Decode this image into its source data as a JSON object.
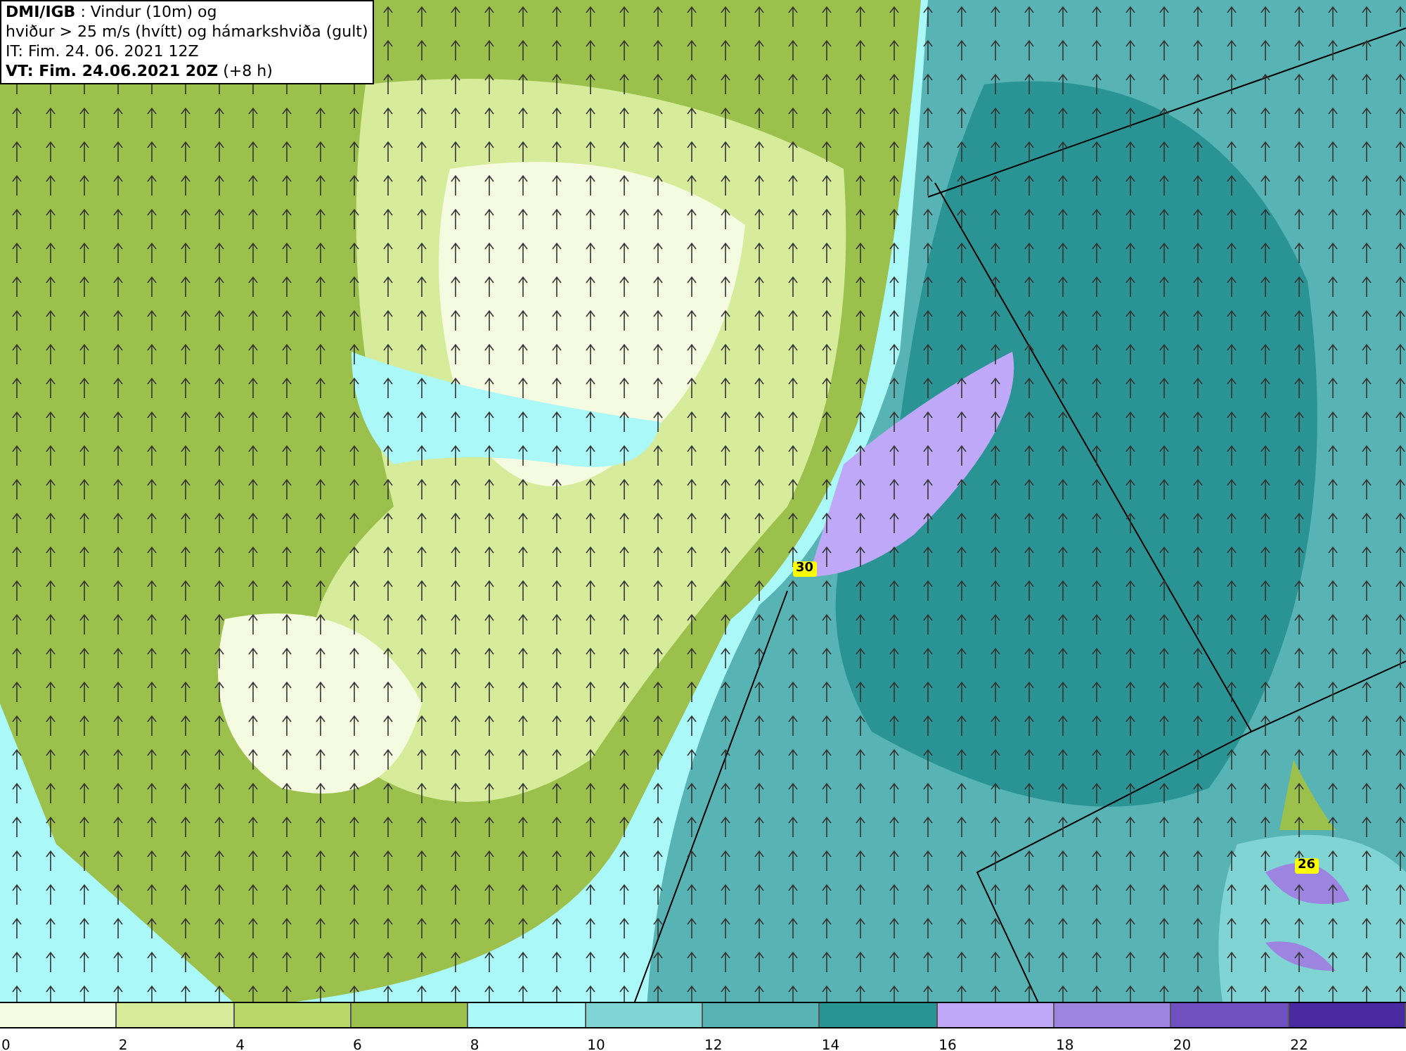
{
  "header": {
    "lines": [
      "**DMI/IGB** : Vindur (10m) og",
      "hviður > 25 m/s (hvítt) og hámarkshviða (gult)",
      "IT: Fim. 24. 06. 2021 12Z",
      "**VT: Fim. 24.06.2021 20Z** (+8 h)"
    ]
  },
  "gust_labels": [
    "30",
    "26"
  ],
  "legend": [
    {
      "label": "0",
      "color": "#f5fbe0"
    },
    {
      "label": "2",
      "color": "#d6ec9a"
    },
    {
      "label": "4",
      "color": "#b8d86a"
    },
    {
      "label": "6",
      "color": "#9cc04c"
    },
    {
      "label": "8",
      "color": "#aaf8f8"
    },
    {
      "label": "10",
      "color": "#80d4d4"
    },
    {
      "label": "12",
      "color": "#58b4b4"
    },
    {
      "label": "14",
      "color": "#2a9494"
    },
    {
      "label": "16",
      "color": "#c0a8f8"
    },
    {
      "label": "18",
      "color": "#9c84e0"
    },
    {
      "label": "20",
      "color": "#7050c0"
    },
    {
      "label": "22",
      "color": "#4a2aa0"
    }
  ]
}
